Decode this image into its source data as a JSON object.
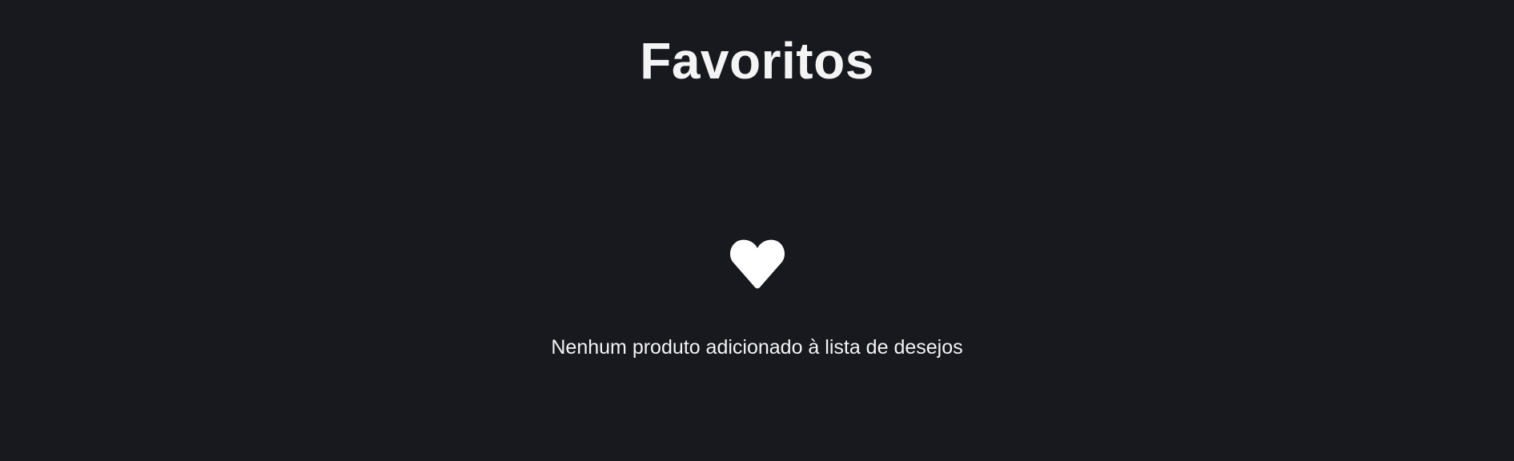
{
  "header": {
    "title": "Favoritos"
  },
  "empty_state": {
    "icon": "heart-icon",
    "message": "Nenhum produto adicionado à lista de desejos"
  },
  "colors": {
    "background": "#18191e",
    "text": "#f4f4f5",
    "icon": "#ffffff"
  }
}
